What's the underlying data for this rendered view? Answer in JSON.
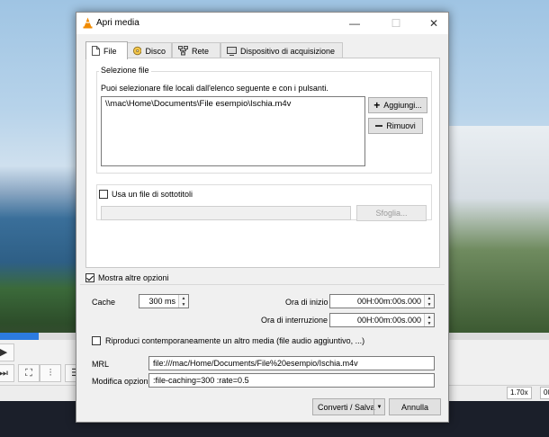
{
  "window": {
    "title": "Apri media"
  },
  "tabs": [
    {
      "label": "File",
      "icon": "file-icon",
      "active": true
    },
    {
      "label": "Disco",
      "icon": "disc-icon"
    },
    {
      "label": "Rete",
      "icon": "network-icon"
    },
    {
      "label": "Dispositivo di acquisizione",
      "icon": "capture-device-icon"
    }
  ],
  "file_selection": {
    "group_title": "Selezione file",
    "description": "Puoi selezionare file locali dall'elenco seguente e con i pulsanti.",
    "files": [
      "\\\\mac\\Home\\Documents\\File esempio\\Ischia.m4v"
    ],
    "add_button": "Aggiungi...",
    "remove_button": "Rimuovi"
  },
  "subtitles": {
    "checkbox_label": "Usa un file di sottotitoli",
    "checked": false,
    "path_value": "",
    "browse_button": "Sfoglia..."
  },
  "more_options": {
    "label": "Mostra altre opzioni",
    "checked": true
  },
  "options": {
    "cache_label": "Cache",
    "cache_value": "300 ms",
    "start_label": "Ora di inizio",
    "start_value": "00H:00m:00s.000",
    "stop_label": "Ora di interruzione",
    "stop_value": "00H:00m:00s.000",
    "play_another_label": "Riproduci contemporaneamente un altro media (file audio aggiuntivo, ...)",
    "play_another_checked": false,
    "mrl_label": "MRL",
    "mrl_value": "file:///mac/Home/Documents/File%20esempio/Ischia.m4v",
    "edit_options_label": "Modifica opzioni",
    "edit_options_value": ":file-caching=300 :rate=0.5"
  },
  "footer": {
    "convert_button": "Converti / Salva",
    "cancel_button": "Annulla"
  },
  "background_player": {
    "speed": "1.70x",
    "time_fragment": "00",
    "progress_fraction": 0.07
  },
  "colors": {
    "accent": "#2c7be0",
    "vlc_orange": "#f08a00"
  }
}
